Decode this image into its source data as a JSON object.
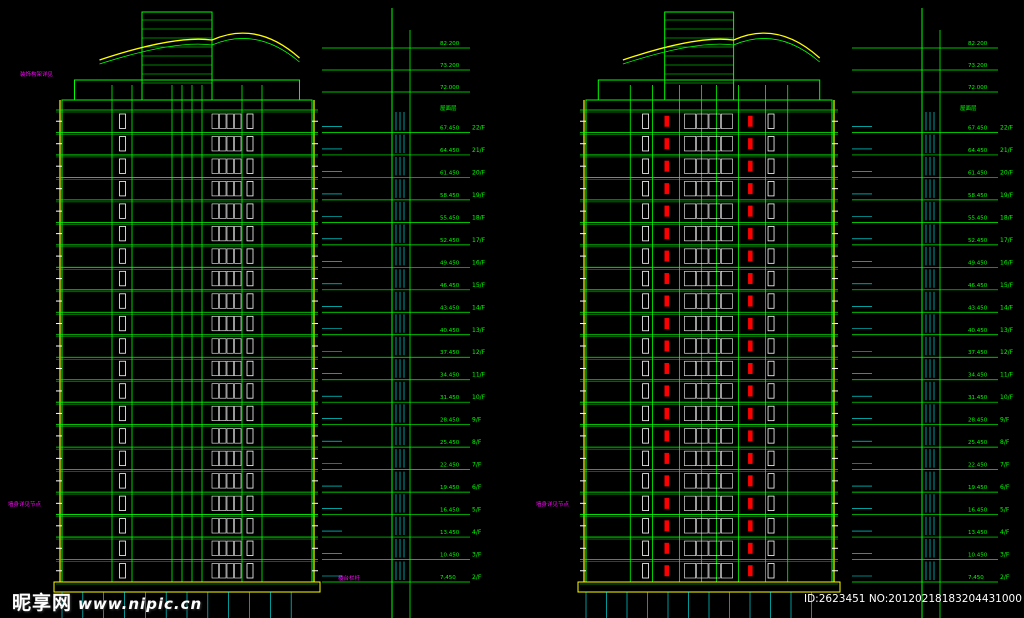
{
  "watermark": {
    "site_cn": "昵享网",
    "site_url": "www.nipic.cn"
  },
  "image_id": "ID:2623451 NO:20120218183204431000",
  "colors": {
    "background": "#000000",
    "structure": "#00ff00",
    "outline": "#ffff00",
    "window": "#ffffff",
    "dimension": "#00ffff",
    "accent": "#ff0000",
    "note": "#ff00ff"
  },
  "floors": [
    "2/F",
    "3/F",
    "4/F",
    "5/F",
    "6/F",
    "7/F",
    "8/F",
    "9/F",
    "10/F",
    "11/F",
    "12/F",
    "13/F",
    "14/F",
    "15/F",
    "16/F",
    "17/F",
    "18/F",
    "19/F",
    "20/F",
    "21/F",
    "22/F"
  ],
  "floor_heights": [
    "7.450",
    "10.450",
    "13.450",
    "16.450",
    "19.450",
    "22.450",
    "25.450",
    "28.450",
    "31.450",
    "34.450",
    "37.450",
    "40.450",
    "43.450",
    "46.450",
    "49.450",
    "52.450",
    "55.450",
    "58.450",
    "61.450",
    "64.450",
    "67.450"
  ],
  "top_levels": [
    "72.000",
    "73.200",
    "82.200"
  ],
  "labels": {
    "roof_note": "屋面层",
    "left_note": "墙身详见节点",
    "bottom_note": "楼台栏杆",
    "top_note": "装饰构架详见"
  }
}
